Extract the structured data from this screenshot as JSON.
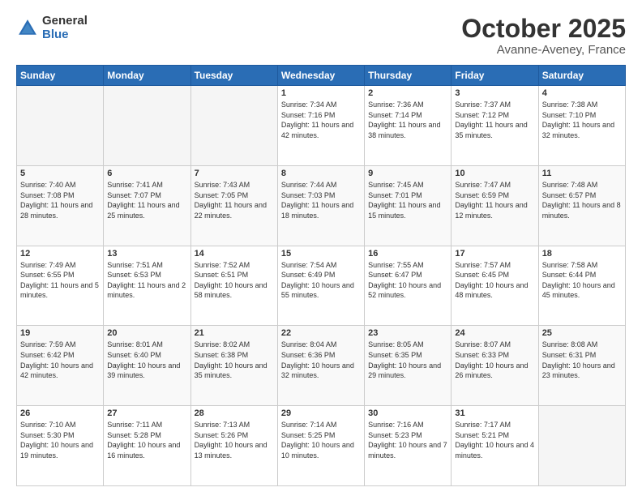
{
  "header": {
    "logo_general": "General",
    "logo_blue": "Blue",
    "month_title": "October 2025",
    "location": "Avanne-Aveney, France"
  },
  "weekdays": [
    "Sunday",
    "Monday",
    "Tuesday",
    "Wednesday",
    "Thursday",
    "Friday",
    "Saturday"
  ],
  "rows": [
    [
      {
        "day": "",
        "empty": true
      },
      {
        "day": "",
        "empty": true
      },
      {
        "day": "",
        "empty": true
      },
      {
        "day": "1",
        "sunrise": "7:34 AM",
        "sunset": "7:16 PM",
        "daylight": "11 hours and 42 minutes."
      },
      {
        "day": "2",
        "sunrise": "7:36 AM",
        "sunset": "7:14 PM",
        "daylight": "11 hours and 38 minutes."
      },
      {
        "day": "3",
        "sunrise": "7:37 AM",
        "sunset": "7:12 PM",
        "daylight": "11 hours and 35 minutes."
      },
      {
        "day": "4",
        "sunrise": "7:38 AM",
        "sunset": "7:10 PM",
        "daylight": "11 hours and 32 minutes."
      }
    ],
    [
      {
        "day": "5",
        "sunrise": "7:40 AM",
        "sunset": "7:08 PM",
        "daylight": "11 hours and 28 minutes."
      },
      {
        "day": "6",
        "sunrise": "7:41 AM",
        "sunset": "7:07 PM",
        "daylight": "11 hours and 25 minutes."
      },
      {
        "day": "7",
        "sunrise": "7:43 AM",
        "sunset": "7:05 PM",
        "daylight": "11 hours and 22 minutes."
      },
      {
        "day": "8",
        "sunrise": "7:44 AM",
        "sunset": "7:03 PM",
        "daylight": "11 hours and 18 minutes."
      },
      {
        "day": "9",
        "sunrise": "7:45 AM",
        "sunset": "7:01 PM",
        "daylight": "11 hours and 15 minutes."
      },
      {
        "day": "10",
        "sunrise": "7:47 AM",
        "sunset": "6:59 PM",
        "daylight": "11 hours and 12 minutes."
      },
      {
        "day": "11",
        "sunrise": "7:48 AM",
        "sunset": "6:57 PM",
        "daylight": "11 hours and 8 minutes."
      }
    ],
    [
      {
        "day": "12",
        "sunrise": "7:49 AM",
        "sunset": "6:55 PM",
        "daylight": "11 hours and 5 minutes."
      },
      {
        "day": "13",
        "sunrise": "7:51 AM",
        "sunset": "6:53 PM",
        "daylight": "11 hours and 2 minutes."
      },
      {
        "day": "14",
        "sunrise": "7:52 AM",
        "sunset": "6:51 PM",
        "daylight": "10 hours and 58 minutes."
      },
      {
        "day": "15",
        "sunrise": "7:54 AM",
        "sunset": "6:49 PM",
        "daylight": "10 hours and 55 minutes."
      },
      {
        "day": "16",
        "sunrise": "7:55 AM",
        "sunset": "6:47 PM",
        "daylight": "10 hours and 52 minutes."
      },
      {
        "day": "17",
        "sunrise": "7:57 AM",
        "sunset": "6:45 PM",
        "daylight": "10 hours and 48 minutes."
      },
      {
        "day": "18",
        "sunrise": "7:58 AM",
        "sunset": "6:44 PM",
        "daylight": "10 hours and 45 minutes."
      }
    ],
    [
      {
        "day": "19",
        "sunrise": "7:59 AM",
        "sunset": "6:42 PM",
        "daylight": "10 hours and 42 minutes."
      },
      {
        "day": "20",
        "sunrise": "8:01 AM",
        "sunset": "6:40 PM",
        "daylight": "10 hours and 39 minutes."
      },
      {
        "day": "21",
        "sunrise": "8:02 AM",
        "sunset": "6:38 PM",
        "daylight": "10 hours and 35 minutes."
      },
      {
        "day": "22",
        "sunrise": "8:04 AM",
        "sunset": "6:36 PM",
        "daylight": "10 hours and 32 minutes."
      },
      {
        "day": "23",
        "sunrise": "8:05 AM",
        "sunset": "6:35 PM",
        "daylight": "10 hours and 29 minutes."
      },
      {
        "day": "24",
        "sunrise": "8:07 AM",
        "sunset": "6:33 PM",
        "daylight": "10 hours and 26 minutes."
      },
      {
        "day": "25",
        "sunrise": "8:08 AM",
        "sunset": "6:31 PM",
        "daylight": "10 hours and 23 minutes."
      }
    ],
    [
      {
        "day": "26",
        "sunrise": "7:10 AM",
        "sunset": "5:30 PM",
        "daylight": "10 hours and 19 minutes."
      },
      {
        "day": "27",
        "sunrise": "7:11 AM",
        "sunset": "5:28 PM",
        "daylight": "10 hours and 16 minutes."
      },
      {
        "day": "28",
        "sunrise": "7:13 AM",
        "sunset": "5:26 PM",
        "daylight": "10 hours and 13 minutes."
      },
      {
        "day": "29",
        "sunrise": "7:14 AM",
        "sunset": "5:25 PM",
        "daylight": "10 hours and 10 minutes."
      },
      {
        "day": "30",
        "sunrise": "7:16 AM",
        "sunset": "5:23 PM",
        "daylight": "10 hours and 7 minutes."
      },
      {
        "day": "31",
        "sunrise": "7:17 AM",
        "sunset": "5:21 PM",
        "daylight": "10 hours and 4 minutes."
      },
      {
        "day": "",
        "empty": true
      }
    ]
  ]
}
